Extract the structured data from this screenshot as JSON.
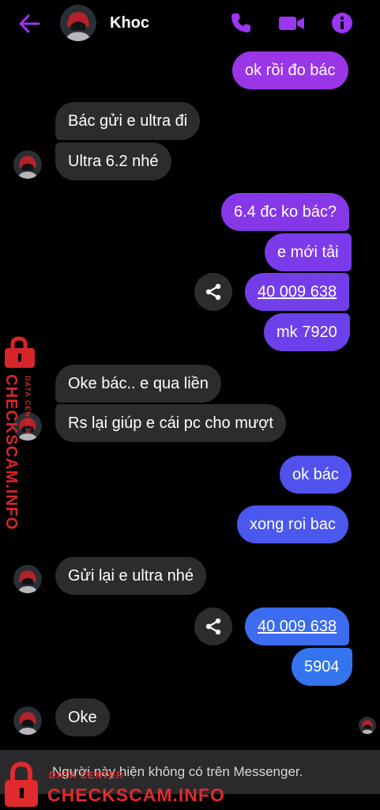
{
  "header": {
    "name": "Khoc",
    "icons": [
      "back-arrow-icon",
      "phone-icon",
      "video-camera-icon",
      "info-icon"
    ],
    "accent_color": "#9b36f2"
  },
  "messages": [
    {
      "side": "out",
      "text": "ok rồi đo bác",
      "color": "#9a35e8"
    },
    {
      "side": "in",
      "text": "Bác gửi e ultra đi"
    },
    {
      "side": "in",
      "text": "Ultra 6.2 nhé"
    },
    {
      "side": "out",
      "text": "6.4 đc ko bác?",
      "color": "#8638e8"
    },
    {
      "side": "out",
      "text": "e mới tải",
      "color": "#7c3bea"
    },
    {
      "side": "out",
      "text": "40 009 638",
      "link": true,
      "color": "#733eea"
    },
    {
      "side": "out",
      "text": "mk 7920",
      "color": "#6c40ea"
    },
    {
      "side": "in",
      "text": "Oke bác.. e qua liền"
    },
    {
      "side": "in",
      "text": "Rs lại giúp e cái pc cho mượt"
    },
    {
      "side": "out",
      "text": "ok bác",
      "color": "#5152ee"
    },
    {
      "side": "out",
      "text": "xong roi bac",
      "color": "#4a58ee"
    },
    {
      "side": "in",
      "text": "Gửi lại e ultra nhé"
    },
    {
      "side": "out",
      "text": "40 009 638",
      "link": true,
      "color": "#3c6cef"
    },
    {
      "side": "out",
      "text": "5904",
      "color": "#3474ef"
    },
    {
      "side": "in",
      "text": "Oke"
    }
  ],
  "footer": {
    "text": "Người này hiện không có trên Messenger."
  },
  "watermark": {
    "brand": "CHECKSCAM.INFO",
    "sub": "DATA CENTER",
    "color": "#d6262a"
  }
}
